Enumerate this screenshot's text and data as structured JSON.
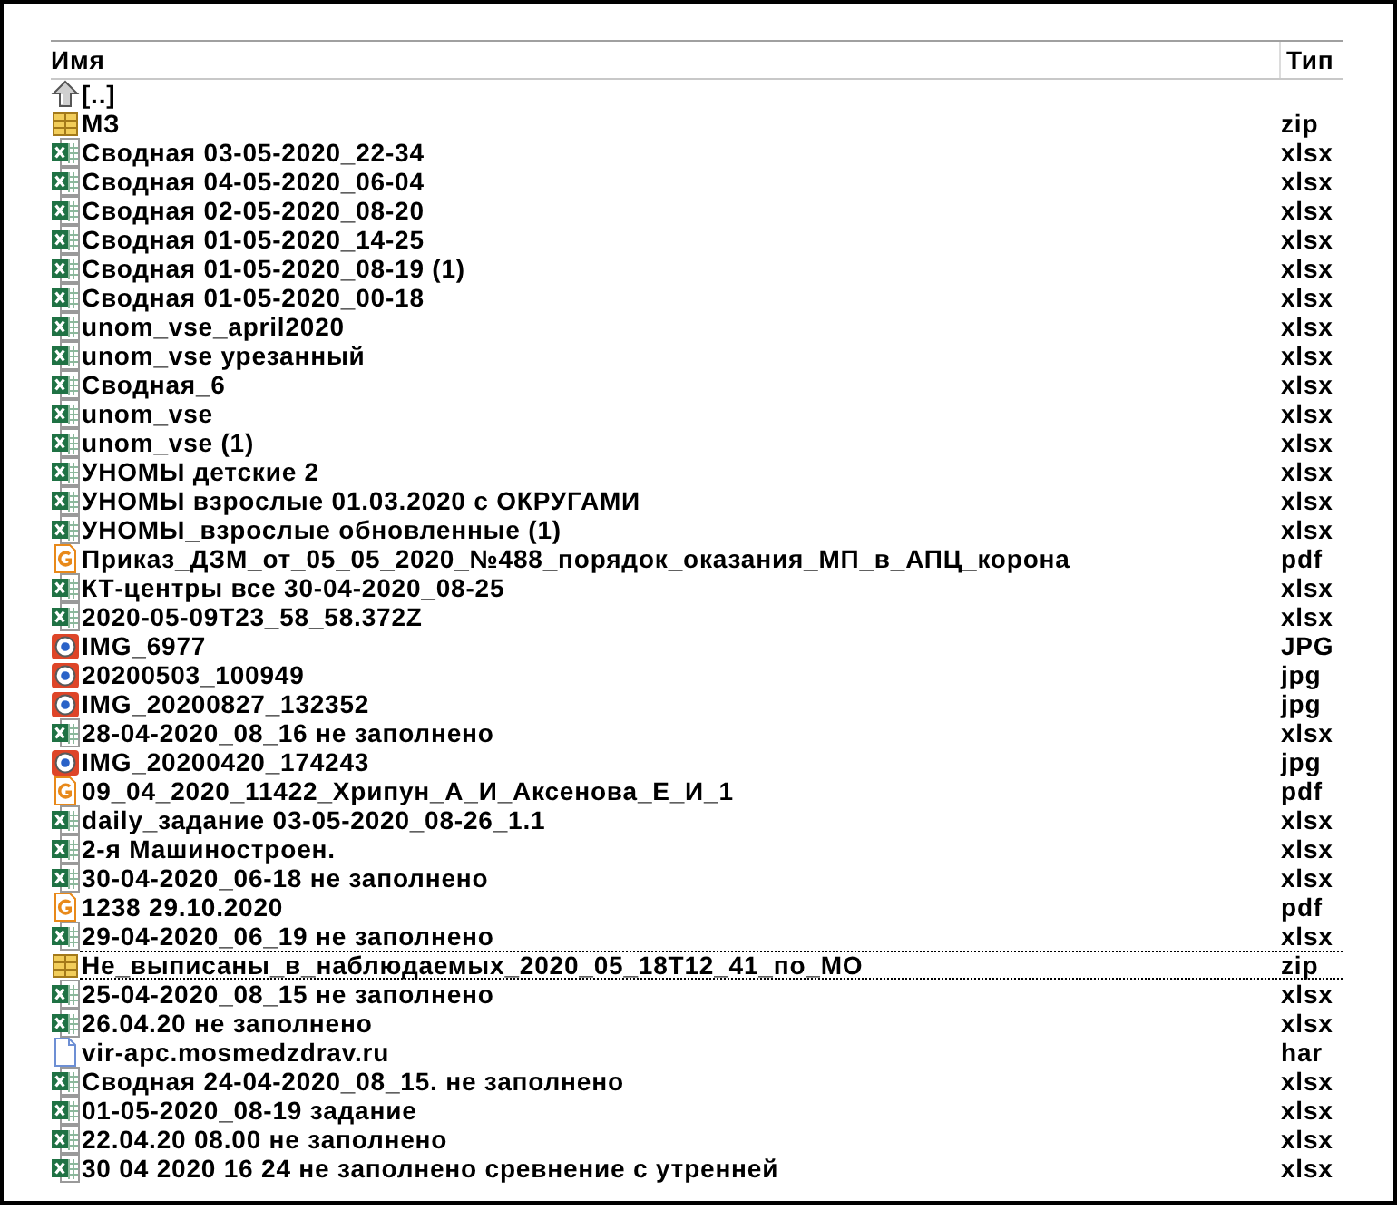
{
  "columns": [
    {
      "label": "Имя"
    },
    {
      "label": "Тип"
    }
  ],
  "files": [
    {
      "kind": "up",
      "name": "[..]",
      "focused": false
    },
    {
      "kind": "archive",
      "name": "МЗ",
      "type": "zip",
      "focused": false
    },
    {
      "kind": "spreadsheet",
      "name": "Сводная 03-05-2020_22-34",
      "type": "xlsx",
      "focused": false
    },
    {
      "kind": "spreadsheet",
      "name": "Сводная 04-05-2020_06-04",
      "type": "xlsx",
      "focused": false
    },
    {
      "kind": "spreadsheet",
      "name": "Сводная 02-05-2020_08-20",
      "type": "xlsx",
      "focused": false
    },
    {
      "kind": "spreadsheet",
      "name": "Сводная 01-05-2020_14-25",
      "type": "xlsx",
      "focused": false
    },
    {
      "kind": "spreadsheet",
      "name": "Сводная 01-05-2020_08-19 (1)",
      "type": "xlsx",
      "focused": false
    },
    {
      "kind": "spreadsheet",
      "name": "Сводная 01-05-2020_00-18",
      "type": "xlsx",
      "focused": false
    },
    {
      "kind": "spreadsheet",
      "name": "unom_vse_april2020",
      "type": "xlsx",
      "focused": false
    },
    {
      "kind": "spreadsheet",
      "name": "unom_vse урезанный",
      "type": "xlsx",
      "focused": false
    },
    {
      "kind": "spreadsheet",
      "name": "Сводная_6",
      "type": "xlsx",
      "focused": false
    },
    {
      "kind": "spreadsheet",
      "name": "unom_vse",
      "type": "xlsx",
      "focused": false
    },
    {
      "kind": "spreadsheet",
      "name": "unom_vse (1)",
      "type": "xlsx",
      "focused": false
    },
    {
      "kind": "spreadsheet",
      "name": "УНОМЫ детские 2",
      "type": "xlsx",
      "focused": false
    },
    {
      "kind": "spreadsheet",
      "name": "УНОМЫ взрослые 01.03.2020 с ОКРУГАМИ",
      "type": "xlsx",
      "focused": false
    },
    {
      "kind": "spreadsheet",
      "name": "УНОМЫ_взрослые обновленные (1)",
      "type": "xlsx",
      "focused": false
    },
    {
      "kind": "pdf",
      "name": "Приказ_ДЗМ_от_05_05_2020_№488_порядок_оказания_МП_в_АПЦ_корона",
      "type": "pdf",
      "focused": false
    },
    {
      "kind": "spreadsheet",
      "name": "КТ-центры все 30-04-2020_08-25",
      "type": "xlsx",
      "focused": false
    },
    {
      "kind": "spreadsheet",
      "name": "2020-05-09T23_58_58.372Z",
      "type": "xlsx",
      "focused": false
    },
    {
      "kind": "image",
      "name": "IMG_6977",
      "type": "JPG",
      "focused": false
    },
    {
      "kind": "image",
      "name": "20200503_100949",
      "type": "jpg",
      "focused": false
    },
    {
      "kind": "image",
      "name": "IMG_20200827_132352",
      "type": "jpg",
      "focused": false
    },
    {
      "kind": "spreadsheet",
      "name": "28-04-2020_08_16 не заполнено",
      "type": "xlsx",
      "focused": false
    },
    {
      "kind": "image",
      "name": "IMG_20200420_174243",
      "type": "jpg",
      "focused": false
    },
    {
      "kind": "pdf",
      "name": "09_04_2020_11422_Хрипун_А_И_Аксенова_Е_И_1",
      "type": "pdf",
      "focused": false
    },
    {
      "kind": "spreadsheet",
      "name": "daily_задание 03-05-2020_08-26_1.1",
      "type": "xlsx",
      "focused": false
    },
    {
      "kind": "spreadsheet",
      "name": "2-я Машиностроен.",
      "type": "xlsx",
      "focused": false
    },
    {
      "kind": "spreadsheet",
      "name": "30-04-2020_06-18 не заполнено",
      "type": "xlsx",
      "focused": false
    },
    {
      "kind": "pdf",
      "name": "1238 29.10.2020",
      "type": "pdf",
      "focused": false
    },
    {
      "kind": "spreadsheet",
      "name": "29-04-2020_06_19 не заполнено",
      "type": "xlsx",
      "focused": false
    },
    {
      "kind": "archive",
      "name": "Не_выписаны_в_наблюдаемых_2020_05_18T12_41_по_МО",
      "type": "zip",
      "focused": true
    },
    {
      "kind": "spreadsheet",
      "name": "25-04-2020_08_15 не заполнено",
      "type": "xlsx",
      "focused": false
    },
    {
      "kind": "spreadsheet",
      "name": "26.04.20 не заполнено",
      "type": "xlsx",
      "focused": false
    },
    {
      "kind": "document",
      "name": "vir-apc.mosmedzdrav.ru",
      "type": "har",
      "focused": false
    },
    {
      "kind": "spreadsheet",
      "name": "Сводная 24-04-2020_08_15. не заполнено",
      "type": "xlsx",
      "focused": false
    },
    {
      "kind": "spreadsheet",
      "name": "01-05-2020_08-19 задание",
      "type": "xlsx",
      "focused": false
    },
    {
      "kind": "spreadsheet",
      "name": "22.04.20 08.00 не заполнено",
      "type": "xlsx",
      "focused": false
    },
    {
      "kind": "spreadsheet",
      "name": "30 04 2020 16 24 не заполнено сревнение с утренней",
      "type": "xlsx",
      "focused": false
    }
  ]
}
